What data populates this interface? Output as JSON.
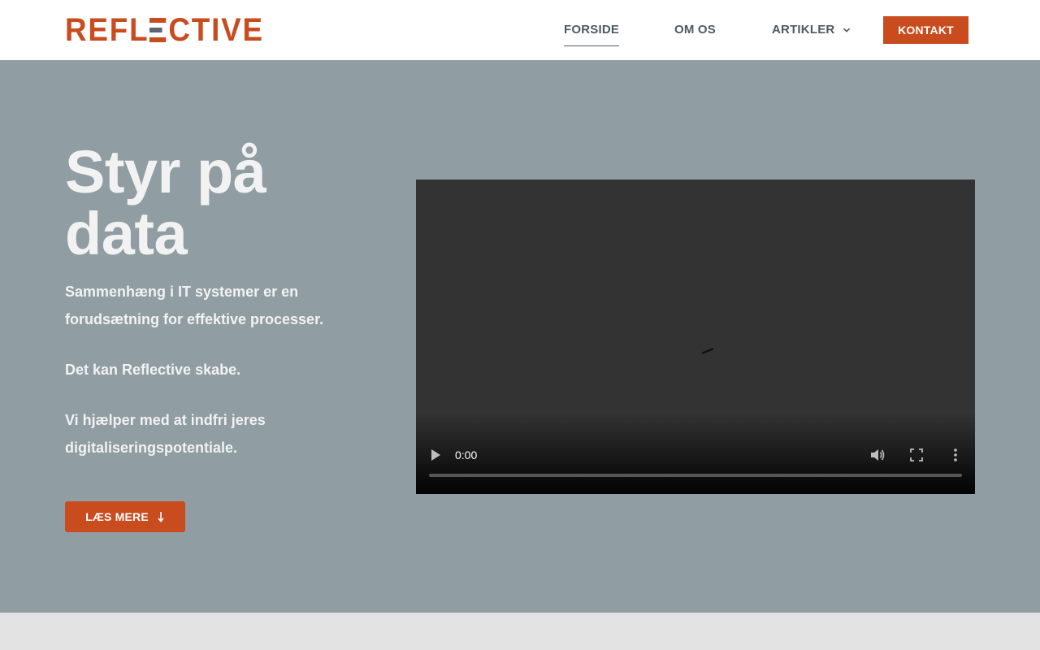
{
  "header": {
    "logo_text": "REFLECTIVE",
    "nav": {
      "forside": "FORSIDE",
      "om_os": "OM OS",
      "artikler": "ARTIKLER",
      "kontakt": "KONTAKT"
    },
    "active_item": "FORSIDE"
  },
  "hero": {
    "title": "Styr på data",
    "paragraph1": "Sammenhæng i IT systemer er en forudsætning for effektive processer.",
    "paragraph2": "Det kan Reflective skabe.",
    "paragraph3": "Vi hjælper med at indfri jeres digitaliseringspotentiale.",
    "cta_label": "LÆS MERE"
  },
  "video": {
    "current_time": "0:00",
    "progress": 0
  },
  "icons": {
    "nav_dropdown": "chevron-down-icon",
    "cta": "arrow-down-icon",
    "video_play": "play-icon",
    "video_volume": "volume-icon",
    "video_fullscreen": "fullscreen-icon",
    "video_more": "more-vert-icon",
    "video_loading": "loading-spinner-icon"
  },
  "colors": {
    "brand_orange": "#c94c1f",
    "logo_gray": "#5a6770",
    "nav_text": "#4b5a63",
    "hero_bg": "#909da3",
    "hero_text": "#f2f2f2",
    "video_bg": "#333333",
    "page_bg": "#e3e3e3"
  }
}
